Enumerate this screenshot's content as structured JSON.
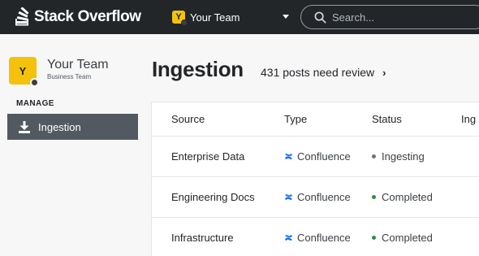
{
  "header": {
    "logo_text": "Stack Overflow",
    "team_badge_letter": "Y",
    "team_name": "Your Team",
    "search_placeholder": "Search..."
  },
  "sidebar": {
    "avatar_letter": "Y",
    "team_name": "Your Team",
    "team_subtitle": "Business Team",
    "section_label": "MANAGE",
    "nav_items": [
      {
        "label": "Ingestion",
        "icon": "download-icon",
        "active": true
      }
    ]
  },
  "main": {
    "title": "Ingestion",
    "review_link": "431 posts need review",
    "table": {
      "columns": [
        "Source",
        "Type",
        "Status",
        "Ing"
      ],
      "rows": [
        {
          "source": "Enterprise Data",
          "type": "Confluence",
          "status": "Ingesting",
          "status_color": "#6a737c"
        },
        {
          "source": "Engineering Docs",
          "type": "Confluence",
          "status": "Completed",
          "status_color": "#2f8a4a"
        },
        {
          "source": "Infrastructure",
          "type": "Confluence",
          "status": "Completed",
          "status_color": "#2f8a4a"
        }
      ]
    }
  },
  "colors": {
    "topbar": "#232629",
    "brand_yellow": "#f4c20d",
    "confluence_blue": "#1f6feb",
    "nav_active": "#525960"
  }
}
